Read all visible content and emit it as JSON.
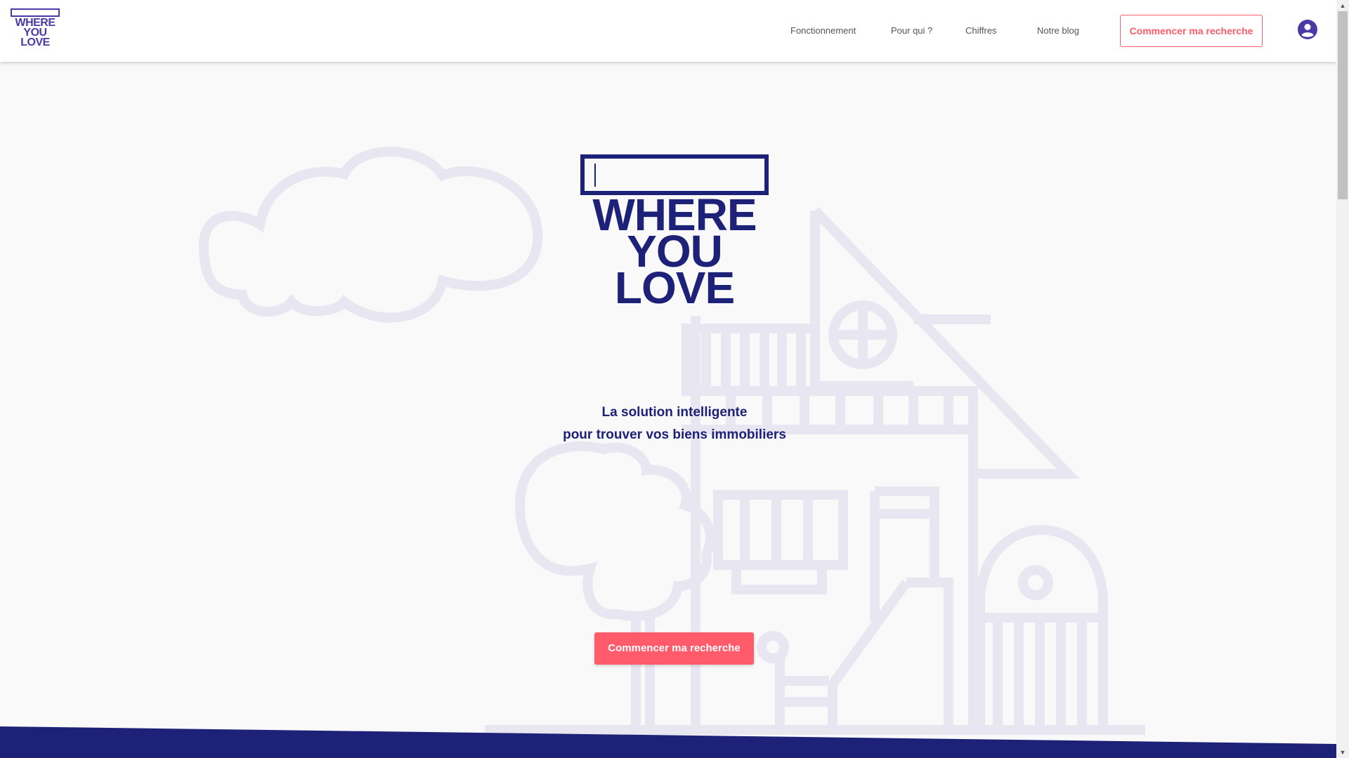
{
  "header": {
    "logo_text": "WHERE YOU LOVE",
    "nav": [
      {
        "label": "Fonctionnement"
      },
      {
        "label": "Pour qui ?"
      },
      {
        "label": "Chiffres"
      },
      {
        "label": "Notre blog"
      }
    ],
    "cta_label": "Commencer ma recherche",
    "user_icon": "user-circle-icon"
  },
  "hero": {
    "logo_text": "WHERE YOU LOVE",
    "tagline_line1": "La solution intelligente",
    "tagline_line2": "pour trouver vos biens immobiliers",
    "cta_label": "Commencer ma recherche"
  },
  "colors": {
    "brand_navy": "#1d2177",
    "brand_purple": "#4a3aa8",
    "accent_coral": "#ff5b6b",
    "illustration": "#e8e6f1",
    "background": "#f9f9fa"
  }
}
